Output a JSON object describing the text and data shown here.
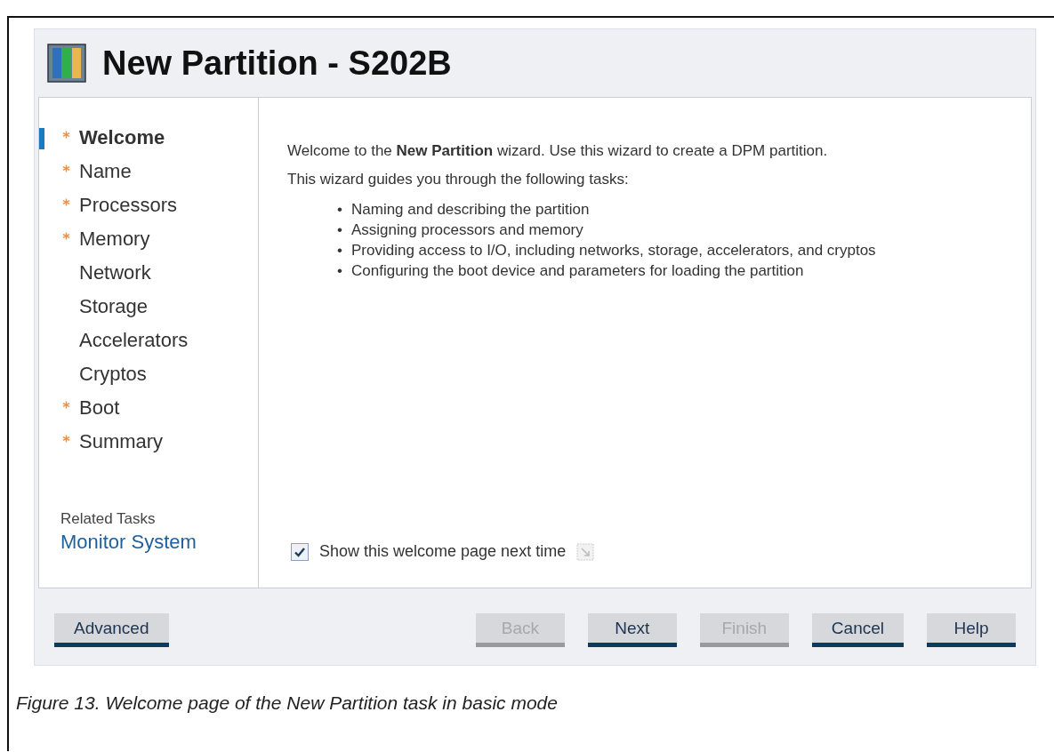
{
  "window": {
    "title": "New Partition - S202B"
  },
  "nav": {
    "items": [
      {
        "label": "Welcome",
        "required": true,
        "selected": true
      },
      {
        "label": "Name",
        "required": true,
        "selected": false
      },
      {
        "label": "Processors",
        "required": true,
        "selected": false
      },
      {
        "label": "Memory",
        "required": true,
        "selected": false
      },
      {
        "label": "Network",
        "required": false,
        "selected": false
      },
      {
        "label": "Storage",
        "required": false,
        "selected": false
      },
      {
        "label": "Accelerators",
        "required": false,
        "selected": false
      },
      {
        "label": "Cryptos",
        "required": false,
        "selected": false
      },
      {
        "label": "Boot",
        "required": true,
        "selected": false
      },
      {
        "label": "Summary",
        "required": true,
        "selected": false
      }
    ],
    "related_heading": "Related Tasks",
    "related_link": "Monitor System"
  },
  "content": {
    "intro": "Welcome to the **New Partition** wizard. Use this wizard to create a DPM partition.",
    "lead": "This wizard guides you through the following tasks:",
    "tasks": [
      {
        "bullet": "•",
        "text": "Naming and describing the partition"
      },
      {
        "bullet": "•",
        "text": "Assigning processors and memory"
      },
      {
        "bullet": "•",
        "text": "Providing access to I/O, including networks, storage, accelerators, and cryptos"
      },
      {
        "bullet": "•",
        "text": "Configuring the boot device and parameters for loading the partition"
      }
    ],
    "checkbox": {
      "label": "Show this welcome page next time",
      "checked": true
    }
  },
  "buttons_left": [
    {
      "label": "Advanced",
      "disabled": false
    }
  ],
  "buttons_right": [
    {
      "label": "Back",
      "disabled": true
    },
    {
      "label": "Next",
      "disabled": false
    },
    {
      "label": "Finish",
      "disabled": true
    },
    {
      "label": "Cancel",
      "disabled": false
    },
    {
      "label": "Help",
      "disabled": false
    }
  ],
  "caption": "Figure 13. Welcome page of the New Partition task in basic mode"
}
